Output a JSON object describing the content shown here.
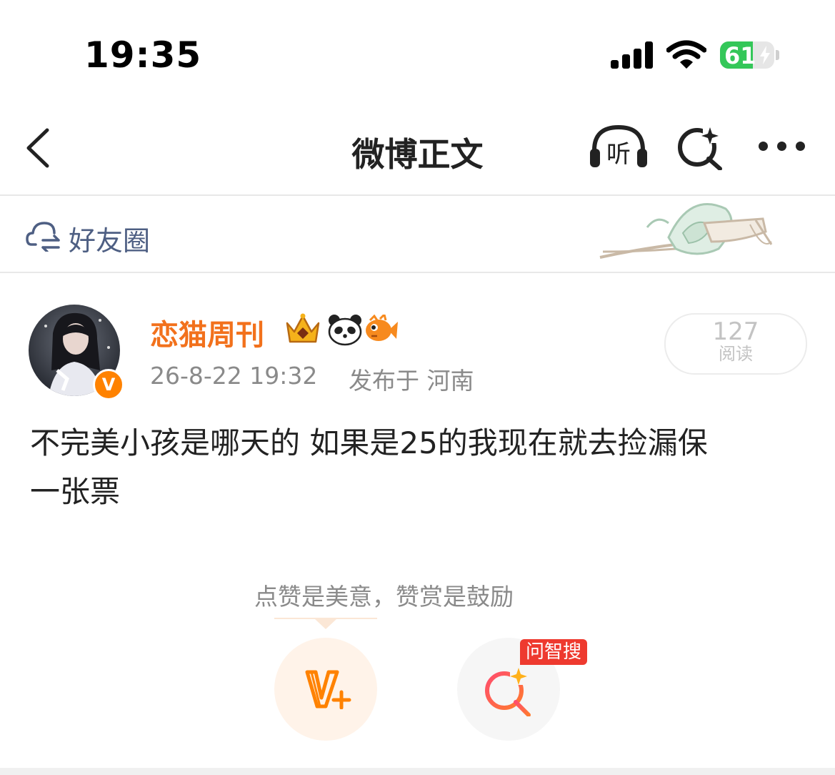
{
  "status_bar": {
    "time": "19:35",
    "battery_level": "61",
    "icons": [
      "cellular-signal-icon",
      "wifi-icon",
      "battery-charging-icon"
    ],
    "battery_color": "#34c759"
  },
  "nav": {
    "title": "微博正文",
    "listen_label": "听",
    "icons": [
      "back-chevron-icon",
      "headphones-icon",
      "ai-search-icon",
      "more-icon"
    ]
  },
  "friend_circle": {
    "label": "好友圈",
    "icon": "cloud-sync-icon",
    "label_color": "#4e5f83"
  },
  "post": {
    "author": "恋猫周刊",
    "author_color": "#f2711c",
    "verified_badge": "V",
    "badges": [
      "crown-badge-icon",
      "panda-badge-icon",
      "fish-badge-icon"
    ],
    "time": "26-8-22 19:32",
    "location": "发布于 河南",
    "read_count": "127",
    "read_label": "阅读",
    "content_line1": "不完美小孩是哪天的 如果是25的我现在就去捡漏保",
    "content_line2": "一张票"
  },
  "reward": {
    "tip": "点赞是美意，赞赏是鼓励",
    "reward_icon": "v-plus-reward-icon",
    "ask_icon": "ai-search-icon",
    "ask_tag": "问智搜",
    "accent": "#ff8200",
    "tag_color": "#ee3a2f"
  }
}
